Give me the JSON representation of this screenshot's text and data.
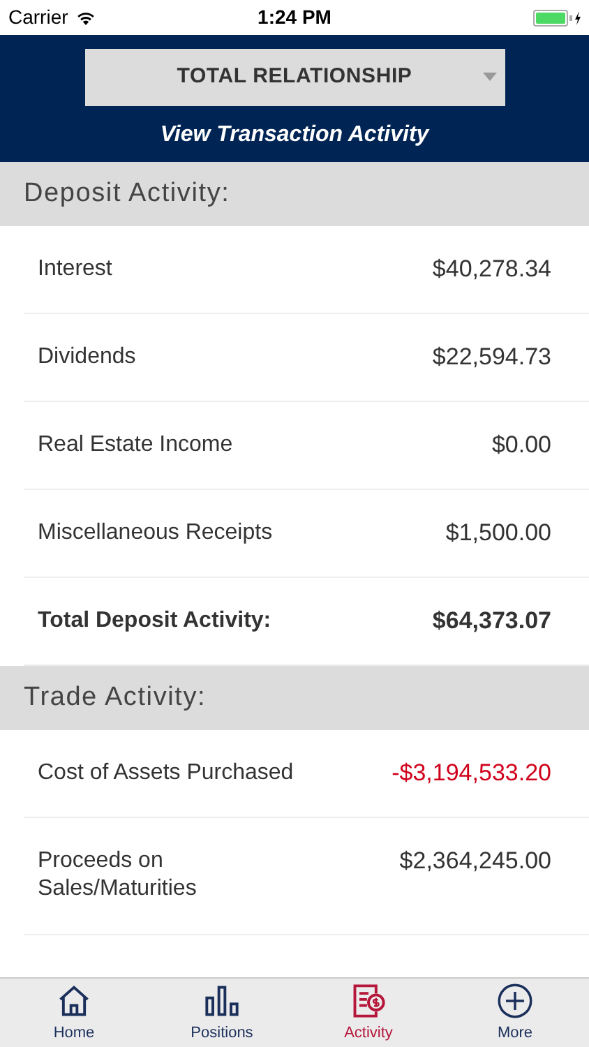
{
  "status_bar": {
    "carrier": "Carrier",
    "time": "1:24 PM"
  },
  "header": {
    "dropdown": "TOTAL RELATIONSHIP",
    "link": "View Transaction Activity"
  },
  "sections": [
    {
      "title": "Deposit Activity:",
      "rows": [
        {
          "label": "Interest",
          "amount": "$40,278.34",
          "kind": "item",
          "negative": false
        },
        {
          "label": "Dividends",
          "amount": "$22,594.73",
          "kind": "item",
          "negative": false
        },
        {
          "label": "Real Estate Income",
          "amount": "$0.00",
          "kind": "item",
          "negative": false
        },
        {
          "label": "Miscellaneous Receipts",
          "amount": "$1,500.00",
          "kind": "item",
          "negative": false
        },
        {
          "label": "Total Deposit Activity:",
          "amount": "$64,373.07",
          "kind": "total",
          "negative": false
        }
      ]
    },
    {
      "title": "Trade Activity:",
      "rows": [
        {
          "label": "Cost of Assets Purchased",
          "amount": "-$3,194,533.20",
          "kind": "item",
          "negative": true
        },
        {
          "label": "Proceeds on Sales/Maturities",
          "amount": "$2,364,245.00",
          "kind": "item",
          "negative": false
        }
      ]
    }
  ],
  "tabs": [
    {
      "label": "Home",
      "kind": "home",
      "selected": false
    },
    {
      "label": "Positions",
      "kind": "bars",
      "selected": false
    },
    {
      "label": "Activity",
      "kind": "doc",
      "selected": true
    },
    {
      "label": "More",
      "kind": "plus",
      "selected": false
    }
  ]
}
